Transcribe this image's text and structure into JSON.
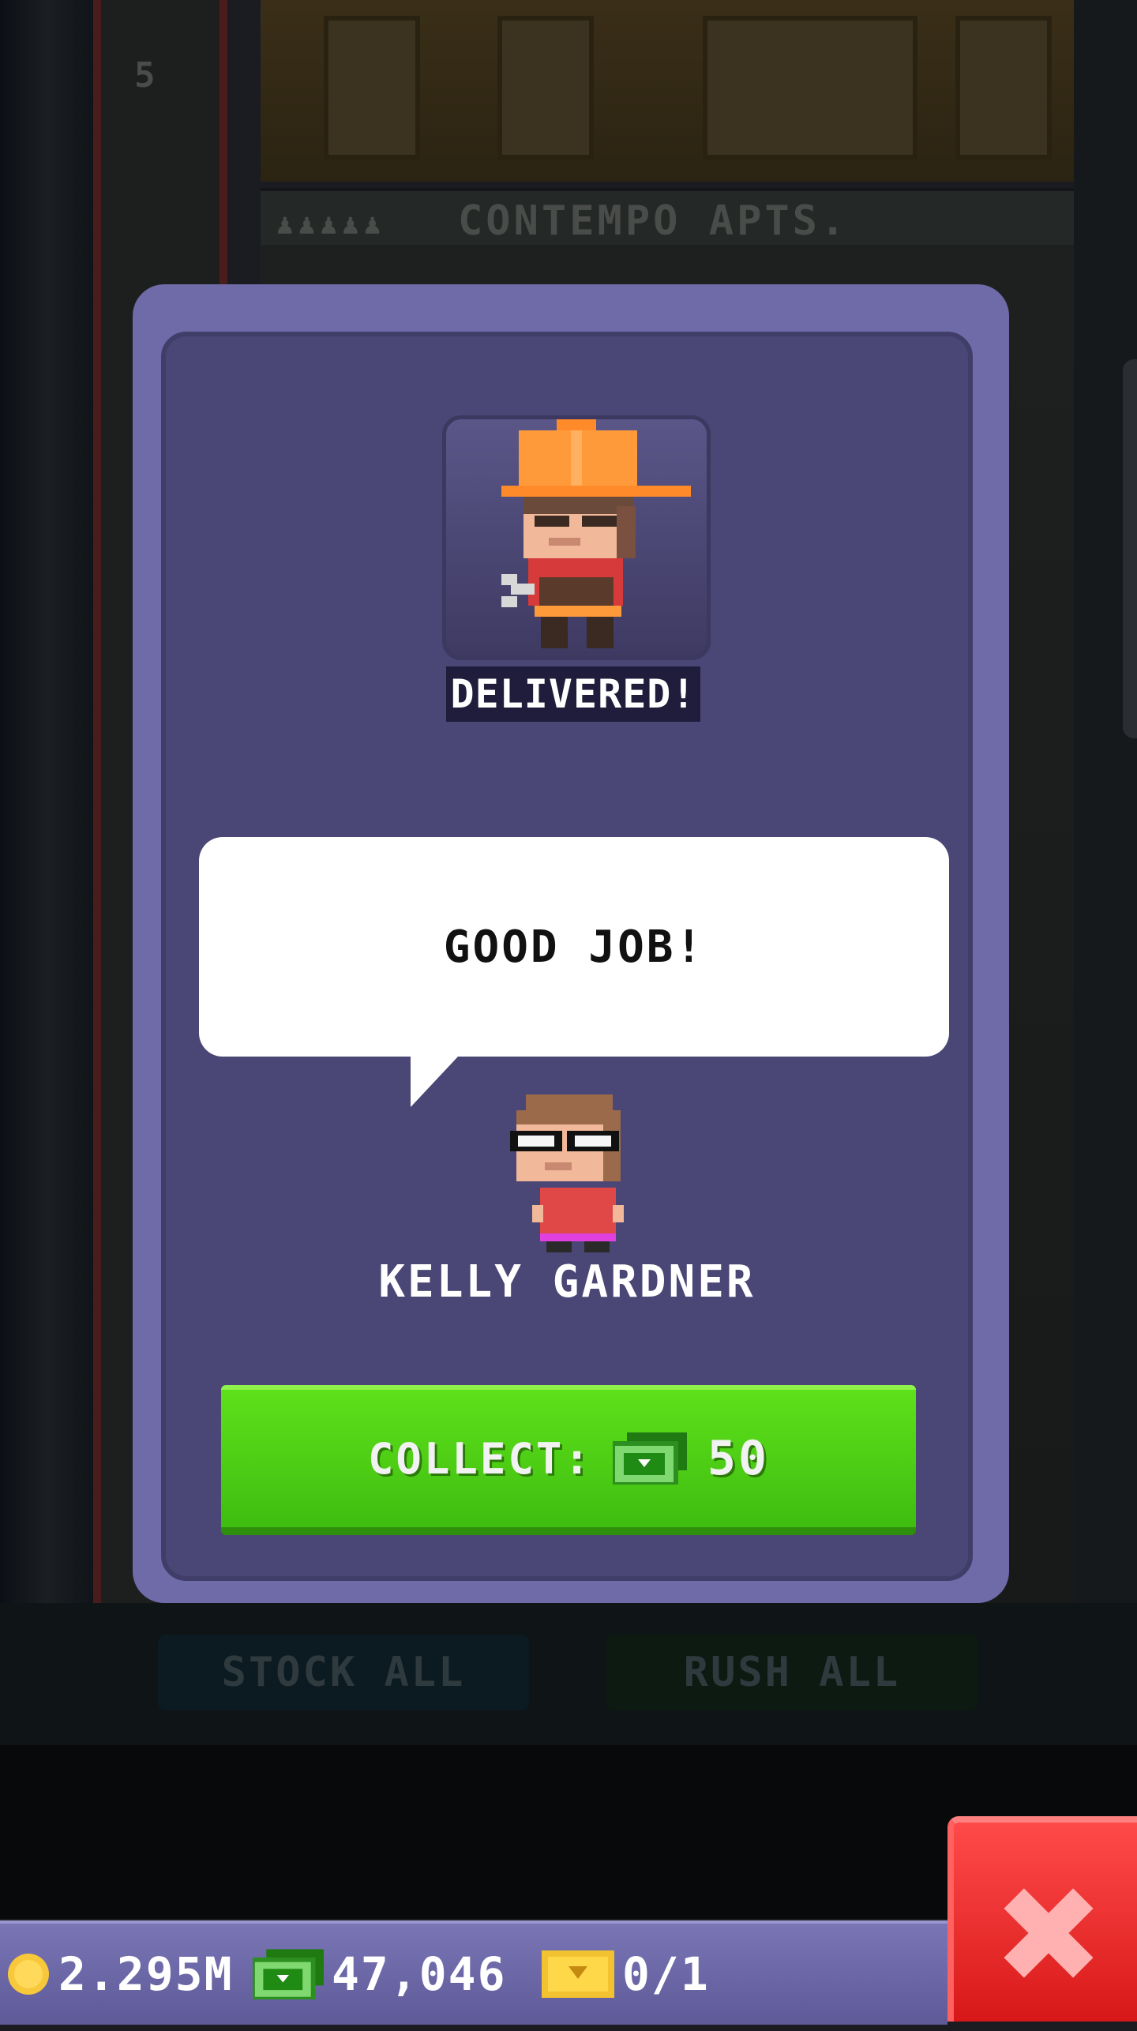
{
  "background": {
    "floor_number": "5",
    "floor_banner": "CONTEMPO APTS.",
    "floor_banner_people": "♟♟♟♟♟",
    "toolbar": {
      "stock_all_label": "STOCK ALL",
      "rush_all_label": "RUSH ALL"
    }
  },
  "modal": {
    "status_label": "DELIVERED!",
    "speech_text": "GOOD JOB!",
    "resident_name": "KELLY GARDNER",
    "collect": {
      "label": "COLLECT:",
      "amount": "50",
      "currency_icon": "tower-bux-icon"
    }
  },
  "statusbar": {
    "coins": "2.295M",
    "tower_bux": "47,046",
    "tickets": "0/1"
  },
  "colors": {
    "modal_frame": "#6f6aa8",
    "modal_inner": "#4a4675",
    "collect_green": "#4fd116",
    "close_red": "#e82424",
    "statusbar": "#6e6aac"
  }
}
